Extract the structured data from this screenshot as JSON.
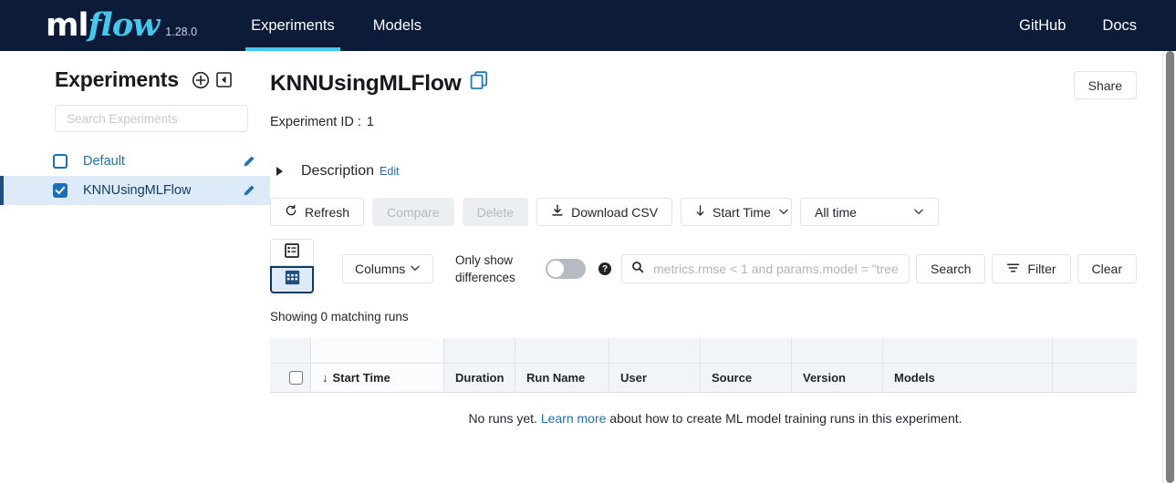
{
  "navbar": {
    "logo_ml": "ml",
    "logo_flow": "flow",
    "version": "1.28.0",
    "tabs": [
      {
        "label": "Experiments",
        "active": true
      },
      {
        "label": "Models",
        "active": false
      }
    ],
    "right_links": [
      {
        "label": "GitHub"
      },
      {
        "label": "Docs"
      }
    ],
    "background": "#0B1B38",
    "accent": "#43C9ED"
  },
  "sidebar": {
    "title": "Experiments",
    "add_icon": "plus-circle-icon",
    "collapse_icon": "collapse-sidebar-icon",
    "search_placeholder": "Search Experiments",
    "search_value": "",
    "items": [
      {
        "label": "Default",
        "checked": false,
        "selected": false
      },
      {
        "label": "KNNUsingMLFlow",
        "checked": true,
        "selected": true
      }
    ]
  },
  "main": {
    "experiment_title": "KNNUsingMLFlow",
    "copy_icon": "copy-icon",
    "share_label": "Share",
    "experiment_id_label": "Experiment ID :",
    "experiment_id_value": "1",
    "description_label": "Description",
    "description_edit": "Edit"
  },
  "toolbar": {
    "refresh_label": "Refresh",
    "refresh_icon": "refresh-icon",
    "compare_label": "Compare",
    "delete_label": "Delete",
    "download_label": "Download CSV",
    "download_icon": "download-icon",
    "sort_label": "Start Time",
    "sort_direction_icon": "arrow-down-icon",
    "time_filter_label": "All time",
    "chevron_icon": "chevron-down-icon"
  },
  "filter_row": {
    "view_list_icon": "list-view-icon",
    "view_grid_icon": "grid-view-icon",
    "active_view": "grid",
    "columns_label": "Columns",
    "only_show_differences_label": "Only show differences",
    "toggle_on": false,
    "help_icon": "question-mark-icon",
    "search_icon": "search-icon",
    "search_placeholder": "metrics.rmse < 1 and params.model = \"tree\"",
    "search_value": "",
    "search_button": "Search",
    "filter_button": "Filter",
    "filter_icon": "filter-icon",
    "clear_button": "Clear"
  },
  "table": {
    "showing_text": "Showing 0 matching runs",
    "columns": [
      "Start Time",
      "Duration",
      "Run Name",
      "User",
      "Source",
      "Version",
      "Models"
    ],
    "sort_indicator": "↓",
    "rows": [],
    "empty_prefix": "No runs yet.",
    "empty_link": "Learn more",
    "empty_suffix": "about how to create ML model training runs in this experiment."
  }
}
